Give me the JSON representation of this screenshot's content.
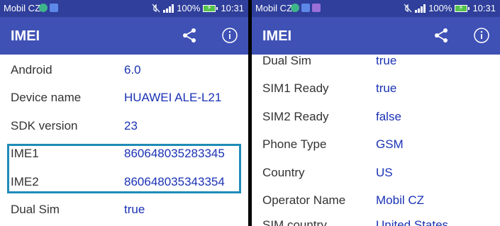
{
  "left_phone": {
    "status": {
      "carrier": "Mobil CZ",
      "battery": "100%",
      "time": "10:31"
    },
    "app_title": "IMEI",
    "rows": [
      {
        "label": "Android",
        "value": "6.0"
      },
      {
        "label": "Device name",
        "value": "HUAWEI ALE-L21"
      },
      {
        "label": "SDK version",
        "value": "23"
      },
      {
        "label": "IME1",
        "value": "860648035283345"
      },
      {
        "label": "IME2",
        "value": "860648035343354"
      },
      {
        "label": "Dual Sim",
        "value": "true"
      }
    ]
  },
  "right_phone": {
    "status": {
      "carrier": "Mobil CZ",
      "battery": "100%",
      "time": "10:31"
    },
    "app_title": "IMEI",
    "rows": [
      {
        "label": "Dual Sim",
        "value": "true"
      },
      {
        "label": "SIM1 Ready",
        "value": "true"
      },
      {
        "label": "SIM2 Ready",
        "value": "false"
      },
      {
        "label": "Phone Type",
        "value": "GSM"
      },
      {
        "label": "Country",
        "value": "US"
      },
      {
        "label": "Operator Name",
        "value": "Mobil CZ"
      },
      {
        "label": "SIM country",
        "value": "United States"
      }
    ]
  },
  "icons": {
    "share": "share-icon",
    "info": "info-icon",
    "mute": "mute-icon",
    "signal": "signal-icon",
    "battery": "battery-charging-icon"
  },
  "colors": {
    "status_bar": "#2f3f9b",
    "app_bar": "#3f51b5",
    "value_text": "#1a32b4",
    "label_text": "#333333",
    "highlight_border": "#1f8cb8"
  }
}
